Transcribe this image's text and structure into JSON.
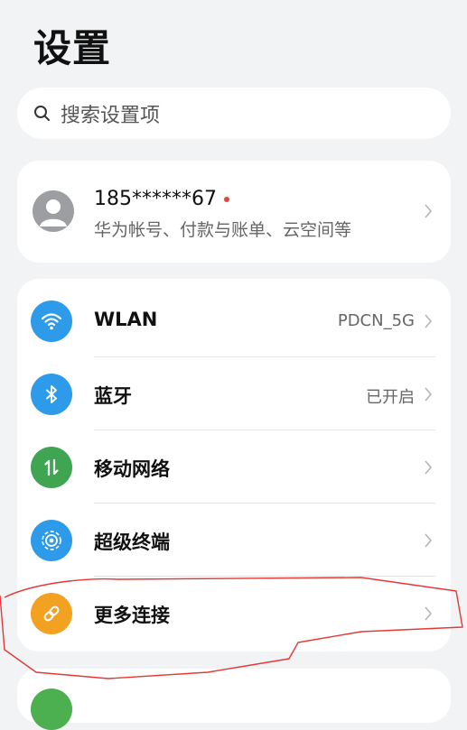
{
  "header": {
    "title": "设置"
  },
  "search": {
    "placeholder": "搜索设置项",
    "icon": "search-icon"
  },
  "account": {
    "name": "185******67",
    "subtitle": "华为帐号、付款与账单、云空间等",
    "has_notification_dot": true,
    "icon": "avatar-icon"
  },
  "settings": [
    {
      "label": "WLAN",
      "value": "PDCN_5G",
      "icon": "wifi-icon",
      "color": "#2E9BEA"
    },
    {
      "label": "蓝牙",
      "value": "已开启",
      "icon": "bluetooth-icon",
      "color": "#2E9BEA"
    },
    {
      "label": "移动网络",
      "value": "",
      "icon": "mobile-data-icon",
      "color": "#3FA553"
    },
    {
      "label": "超级终端",
      "value": "",
      "icon": "super-device-icon",
      "color": "#2E9BEA"
    },
    {
      "label": "更多连接",
      "value": "",
      "icon": "link-icon",
      "color": "#F2A120"
    }
  ],
  "colors": {
    "background": "#F1F3F5",
    "card": "#FFFFFF",
    "annotation": "#E53935",
    "notification_dot": "#E64340"
  }
}
